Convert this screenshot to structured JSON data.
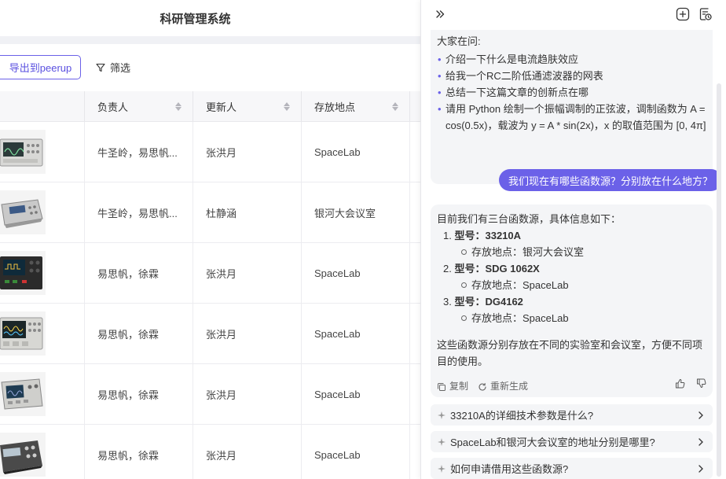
{
  "app": {
    "title": "科研管理系统"
  },
  "toolbar": {
    "export_label": "导出到peerup",
    "filter_label": "筛选"
  },
  "table": {
    "columns": [
      "负责人",
      "更新人",
      "存放地点"
    ],
    "rows": [
      {
        "owner": "牛圣岭，易思帆...",
        "updater": "张洪月",
        "location": "SpaceLab"
      },
      {
        "owner": "牛圣岭，易思帆...",
        "updater": "杜静涵",
        "location": "银河大会议室"
      },
      {
        "owner": "易思帆，徐霖",
        "updater": "张洪月",
        "location": "SpaceLab"
      },
      {
        "owner": "易思帆，徐霖",
        "updater": "张洪月",
        "location": "SpaceLab"
      },
      {
        "owner": "易思帆，徐霖",
        "updater": "张洪月",
        "location": "SpaceLab"
      },
      {
        "owner": "易思帆，徐霖",
        "updater": "张洪月",
        "location": "SpaceLab"
      }
    ]
  },
  "assistant": {
    "suggest": {
      "label": "大家在问:",
      "items": [
        "介绍一下什么是电流趋肤效应",
        "给我一个RC二阶低通滤波器的网表",
        "总结一下这篇文章的创新点在哪",
        "请用 Python 绘制一个振幅调制的正弦波，调制函数为 A = cos(0.5x)，载波为 y = A * sin(2x)，x 的取值范围为 [0, 4π]"
      ]
    },
    "user_question": "我们现在有哪些函数源？分别放在什么地方？",
    "answer": {
      "intro": "目前我们有三台函数源，具体信息如下：",
      "items": [
        {
          "num": "1.",
          "prefix": "型号：",
          "model": "33210A",
          "location": "存放地点：银河大会议室"
        },
        {
          "num": "2.",
          "prefix": "型号：",
          "model": "SDG 1062X",
          "location": "存放地点：SpaceLab"
        },
        {
          "num": "3.",
          "prefix": "型号：",
          "model": "DG4162",
          "location": "存放地点：SpaceLab"
        }
      ],
      "tail": "这些函数源分别存放在不同的实验室和会议室，方便不同项目的使用。",
      "copy_label": "复制",
      "regen_label": "重新生成"
    },
    "followups": [
      "33210A的详细技术参数是什么?",
      "SpaceLab和银河大会议室的地址分别是哪里?",
      "如何申请借用这些函数源?"
    ]
  },
  "colors": {
    "accent": "#6b61e8",
    "card_bg": "#f4f5f7"
  }
}
